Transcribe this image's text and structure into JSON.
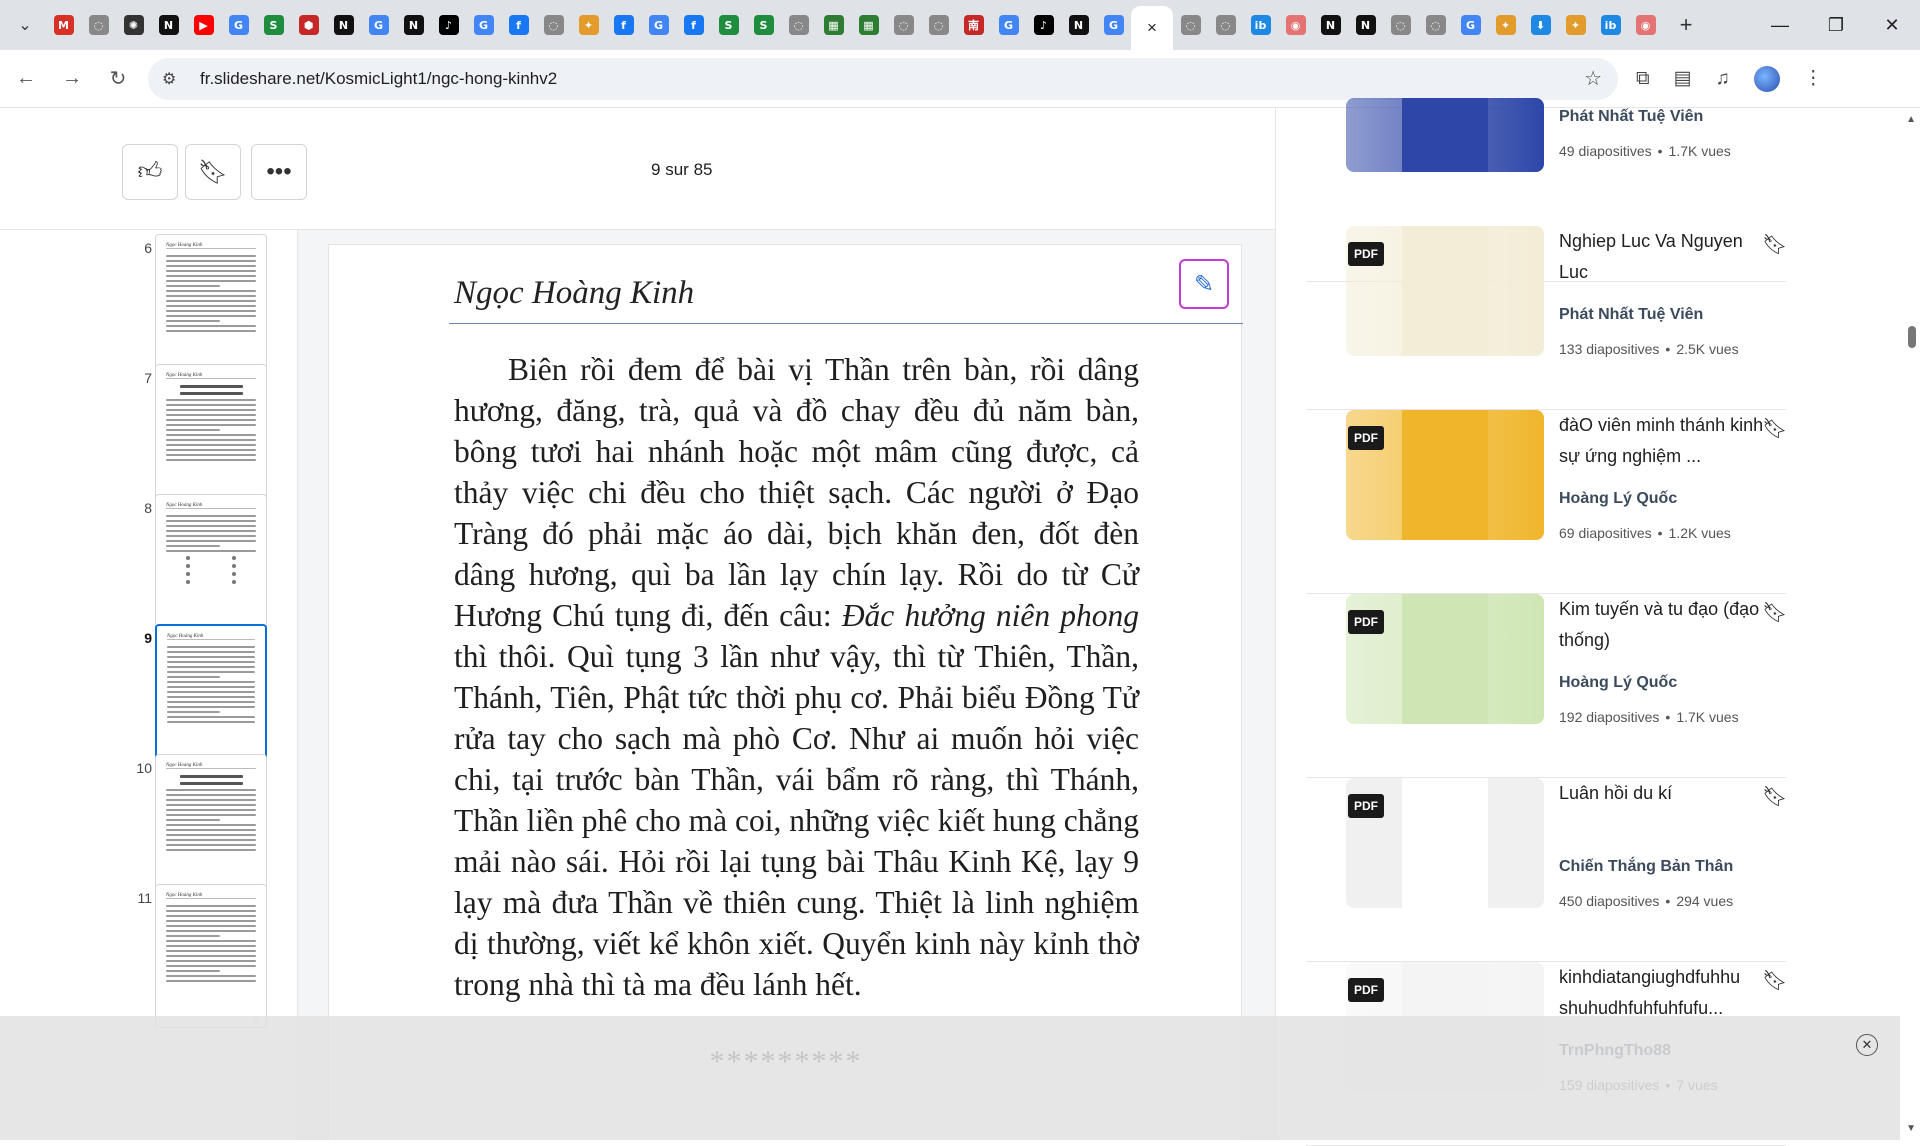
{
  "browser": {
    "active_tab_close": "×",
    "new_tab": "+",
    "url": "fr.slideshare.net/KosmicLight1/ngc-hong-kinhv2",
    "tabs": [
      {
        "icon": "gmail-icon",
        "color": "#d93025",
        "glyph": "M"
      },
      {
        "icon": "generic-page-icon",
        "color": "#888888",
        "glyph": "◌"
      },
      {
        "icon": "chatgpt-icon",
        "color": "#333333",
        "glyph": "✺"
      },
      {
        "icon": "n-logo-icon",
        "color": "#111111",
        "glyph": "N"
      },
      {
        "icon": "youtube-icon",
        "color": "#ff0000",
        "glyph": "▶"
      },
      {
        "icon": "google-icon",
        "color": "#4285f4",
        "glyph": "G"
      },
      {
        "icon": "s-green-icon",
        "color": "#1e8e3e",
        "glyph": "S"
      },
      {
        "icon": "red-hex-icon",
        "color": "#c62828",
        "glyph": "⬢"
      },
      {
        "icon": "n-logo-icon",
        "color": "#111111",
        "glyph": "N"
      },
      {
        "icon": "google-icon",
        "color": "#4285f4",
        "glyph": "G"
      },
      {
        "icon": "n-logo-icon",
        "color": "#111111",
        "glyph": "N"
      },
      {
        "icon": "tiktok-icon",
        "color": "#000000",
        "glyph": "♪"
      },
      {
        "icon": "google-icon",
        "color": "#4285f4",
        "glyph": "G"
      },
      {
        "icon": "facebook-icon",
        "color": "#1877f2",
        "glyph": "f"
      },
      {
        "icon": "generic-page-icon",
        "color": "#888888",
        "glyph": "◌"
      },
      {
        "icon": "ai-icon",
        "color": "#e39b2c",
        "glyph": "✦"
      },
      {
        "icon": "facebook-icon",
        "color": "#1877f2",
        "glyph": "f"
      },
      {
        "icon": "google-icon",
        "color": "#4285f4",
        "glyph": "G"
      },
      {
        "icon": "facebook-icon",
        "color": "#1877f2",
        "glyph": "f"
      },
      {
        "icon": "s-green-icon",
        "color": "#1e8e3e",
        "glyph": "S"
      },
      {
        "icon": "s-green-icon",
        "color": "#1e8e3e",
        "glyph": "S"
      },
      {
        "icon": "generic-page-icon",
        "color": "#888888",
        "glyph": "◌"
      },
      {
        "icon": "green-sheet-icon",
        "color": "#2e7d32",
        "glyph": "▦"
      },
      {
        "icon": "green-sheet-icon",
        "color": "#2e7d32",
        "glyph": "▦"
      },
      {
        "icon": "generic-page-icon",
        "color": "#888888",
        "glyph": "◌"
      },
      {
        "icon": "generic-page-icon",
        "color": "#888888",
        "glyph": "◌"
      },
      {
        "icon": "red-char-icon",
        "color": "#c62828",
        "glyph": "南"
      },
      {
        "icon": "google-icon",
        "color": "#4285f4",
        "glyph": "G"
      },
      {
        "icon": "tiktok-icon",
        "color": "#000000",
        "glyph": "♪"
      },
      {
        "icon": "n-logo-icon",
        "color": "#111111",
        "glyph": "N"
      },
      {
        "icon": "google-icon",
        "color": "#4285f4",
        "glyph": "G"
      }
    ],
    "tabs_after": [
      {
        "icon": "generic-page-icon",
        "color": "#888888",
        "glyph": "◌"
      },
      {
        "icon": "generic-page-icon",
        "color": "#888888",
        "glyph": "◌"
      },
      {
        "icon": "ibb-icon",
        "color": "#1e88e5",
        "glyph": "ib"
      },
      {
        "icon": "pink-circle-icon",
        "color": "#e57373",
        "glyph": "◉"
      },
      {
        "icon": "n-logo-icon",
        "color": "#111111",
        "glyph": "N"
      },
      {
        "icon": "n-logo-icon",
        "color": "#111111",
        "glyph": "N"
      },
      {
        "icon": "generic-page-icon",
        "color": "#888888",
        "glyph": "◌"
      },
      {
        "icon": "generic-page-icon",
        "color": "#888888",
        "glyph": "◌"
      },
      {
        "icon": "google-icon",
        "color": "#4285f4",
        "glyph": "G"
      },
      {
        "icon": "ai-icon",
        "color": "#e39b2c",
        "glyph": "✦"
      },
      {
        "icon": "download-icon",
        "color": "#1e88e5",
        "glyph": "⬇"
      },
      {
        "icon": "ai-icon",
        "color": "#e39b2c",
        "glyph": "✦"
      },
      {
        "icon": "ibb-icon",
        "color": "#1e88e5",
        "glyph": "ib"
      },
      {
        "icon": "pink-circle-icon",
        "color": "#e57373",
        "glyph": "◉"
      }
    ]
  },
  "viewer": {
    "page_current": "9",
    "page_separator": "sur",
    "page_total": "85",
    "thumbnails": [
      {
        "num": "6",
        "type": "text"
      },
      {
        "num": "7",
        "type": "heading"
      },
      {
        "num": "8",
        "type": "grid"
      },
      {
        "num": "9",
        "type": "text",
        "selected": true
      },
      {
        "num": "10",
        "type": "heading"
      },
      {
        "num": "11",
        "type": "text"
      }
    ],
    "document": {
      "header": "Ngọc Hoàng Kinh",
      "body_before": "Biên rồi đem để bài vị Thần trên bàn, rồi dâng hương, đăng, trà, quả và đồ chay đều đủ năm bàn, bông tươi hai nhánh hoặc một mâm cũng được, cả thảy việc chi đều cho thiệt sạch. Các người ở Đạo Tràng đó phải mặc áo dài, bịch khăn đen, đốt đèn dâng hương, quì ba lần lạy chín lạy. Rồi do từ Cử Hương Chú tụng đi, đến câu:",
      "body_italic": "Đắc hưởng niên phong",
      "body_after": "thì thôi. Quì tụng 3 lần như vậy, thì từ Thiên, Thần, Thánh, Tiên, Phật tức thời phụ cơ. Phải biểu Đồng Tử rửa tay cho sạch mà phò  Cơ. Như ai muốn hỏi việc chi, tại trước bàn Thần, vái bẩm rõ ràng, thì Thánh, Thần liền phê cho mà coi, những việc kiết hung chẳng mải nào sái. Hỏi rồi lại tụng bài Thâu Kinh Kệ, lạy 9 lạy mà đưa Thần về thiên cung. Thiệt là linh nghiệm dị thường, viết kể khôn xiết. Quyển kinh này kỉnh thờ trong nhà thì tà ma đều lánh hết.",
      "stars": "*********"
    }
  },
  "related": [
    {
      "title": "",
      "author": "Phát Nhất Tuệ Viên",
      "slides": "49 diapositives",
      "views": "1.7K vues",
      "cover": "#2d46a8",
      "pdf": false
    },
    {
      "title": "Nghiep Luc Va Nguyen Luc",
      "author": "Phát Nhất Tuệ Viên",
      "slides": "133 diapositives",
      "views": "2.5K vues",
      "cover": "#f3ecd6",
      "pdf": true
    },
    {
      "title": "đàO viên minh thánh kinh   sự ứng nghiệm ...",
      "author": "Hoàng Lý Quốc",
      "slides": "69 diapositives",
      "views": "1.2K vues",
      "cover": "#f0b62b",
      "pdf": true
    },
    {
      "title": "Kim tuyến và tu đạo (đạo thống)",
      "author": "Hoàng Lý Quốc",
      "slides": "192 diapositives",
      "views": "1.7K vues",
      "cover": "#cfe6b4",
      "pdf": true
    },
    {
      "title": "Luân hồi du kí",
      "author": "Chiến Thắng Bản Thân",
      "slides": "450 diapositives",
      "views": "294 vues",
      "cover": "#ffffff",
      "pdf": true
    },
    {
      "title": "kinhdiatangiughdfuhhu shuhudhfuhfuhfufu...",
      "author": "TrnPhngTho88",
      "slides": "159 diapositives",
      "views": "7 vues",
      "cover": "#f4f4f4",
      "pdf": true
    }
  ],
  "labels": {
    "pdf": "PDF",
    "dot": "•"
  }
}
